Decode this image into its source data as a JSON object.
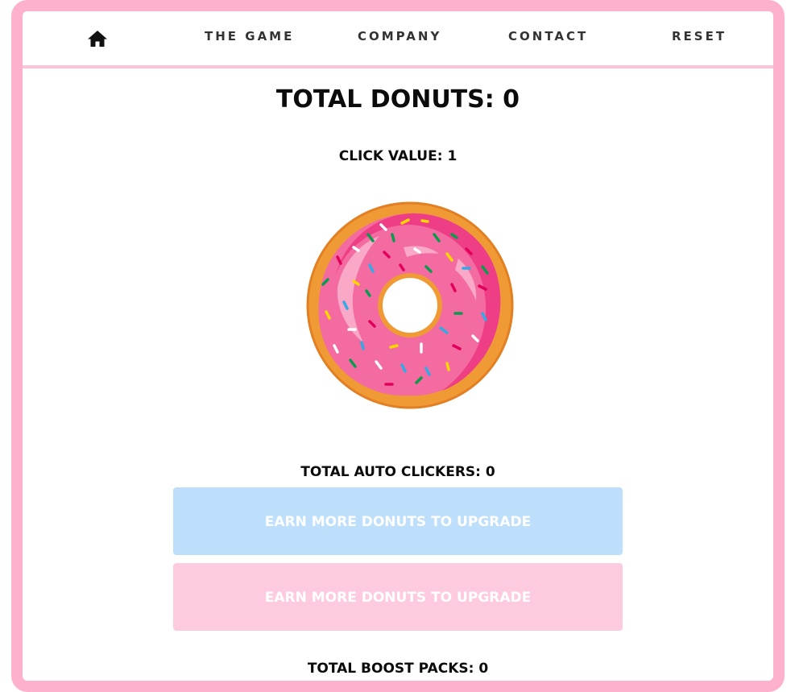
{
  "nav": {
    "home_icon": "home-icon",
    "items": [
      "THE GAME",
      "COMPANY",
      "CONTACT",
      "RESET"
    ]
  },
  "game": {
    "total_donuts": "TOTAL DONUTS: 0",
    "click_value": "CLICK VALUE: 1",
    "donut_icon": "donut-icon",
    "total_auto_clickers": "TOTAL AUTO CLICKERS: 0",
    "auto_clicker_button": "EARN MORE DONUTS TO UPGRADE",
    "boost_button": "EARN MORE DONUTS TO UPGRADE",
    "total_boost_packs": "TOTAL BOOST PACKS: 0"
  },
  "colors": {
    "frame": "#fdb1cd",
    "nav_divider": "#fcc5d7",
    "auto_clicker_button_bg": "#bddffc",
    "boost_button_bg": "#fdcae0",
    "frosting": "#f36ba0",
    "dough": "#f09a36"
  }
}
